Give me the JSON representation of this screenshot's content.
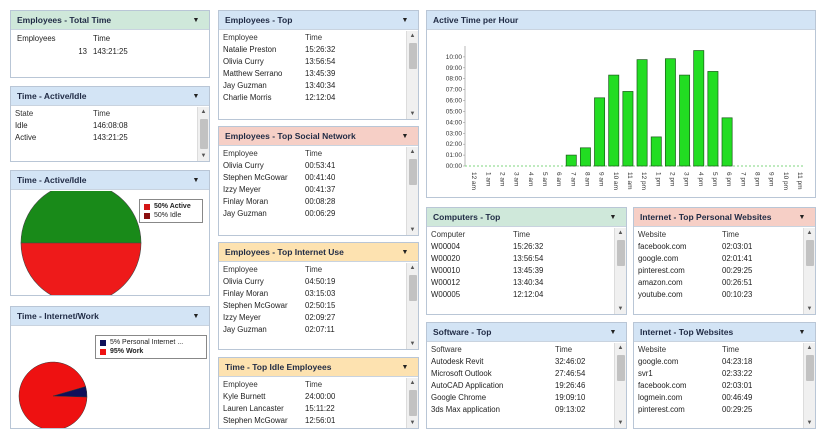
{
  "w1": {
    "title": "Employees - Total Time",
    "cols": [
      "Employees",
      "Time"
    ],
    "rows": [
      [
        "13",
        "143:21:25"
      ]
    ]
  },
  "w2": {
    "title": "Time - Active/Idle",
    "cols": [
      "State",
      "Time"
    ],
    "rows": [
      [
        "Idle",
        "146:08:08"
      ],
      [
        "Active",
        "143:21:25"
      ]
    ]
  },
  "w3": {
    "title": "Time - Active/Idle",
    "legend": [
      {
        "label": "50% Active",
        "color": "#1b8a1b"
      },
      {
        "label": "50% Idle",
        "color": "#e02020"
      }
    ],
    "slices": [
      50,
      50
    ]
  },
  "w4": {
    "title": "Time - Internet/Work",
    "legend": [
      {
        "label": "5% Personal Internet ...",
        "color": "#10105a"
      },
      {
        "label": "95% Work",
        "color": "#ee1111"
      }
    ],
    "slices": [
      5,
      95
    ]
  },
  "w5": {
    "title": "Employees - Top",
    "cols": [
      "Employee",
      "Time"
    ],
    "rows": [
      [
        "Natalie Preston",
        "15:26:32"
      ],
      [
        "Olivia Curry",
        "13:56:54"
      ],
      [
        "Matthew Serrano",
        "13:45:39"
      ],
      [
        "Jay Guzman",
        "13:40:34"
      ],
      [
        "Charlie Morris",
        "12:12:04"
      ]
    ]
  },
  "w6": {
    "title": "Employees - Top Social Network",
    "cols": [
      "Employee",
      "Time"
    ],
    "rows": [
      [
        "Olivia Curry",
        "00:53:41"
      ],
      [
        "Stephen McGowar",
        "00:41:40"
      ],
      [
        "Izzy Meyer",
        "00:41:37"
      ],
      [
        "Finlay Moran",
        "00:08:28"
      ],
      [
        "Jay Guzman",
        "00:06:29"
      ]
    ]
  },
  "w7": {
    "title": "Employees - Top Internet Use",
    "cols": [
      "Employee",
      "Time"
    ],
    "rows": [
      [
        "Olivia Curry",
        "04:50:19"
      ],
      [
        "Finlay Moran",
        "03:15:03"
      ],
      [
        "Stephen McGowar",
        "02:50:15"
      ],
      [
        "Izzy Meyer",
        "02:09:27"
      ],
      [
        "Jay Guzman",
        "02:07:11"
      ]
    ]
  },
  "w8": {
    "title": "Time - Top Idle Employees",
    "cols": [
      "Employee",
      "Time"
    ],
    "rows": [
      [
        "Kyle Burnett",
        "24:00:00"
      ],
      [
        "Lauren Lancaster",
        "15:11:22"
      ],
      [
        "Stephen McGowar",
        "12:56:01"
      ]
    ]
  },
  "w9": {
    "title": "Computers - Top",
    "cols": [
      "Computer",
      "Time"
    ],
    "rows": [
      [
        "W00004",
        "15:26:32"
      ],
      [
        "W00020",
        "13:56:54"
      ],
      [
        "W00010",
        "13:45:39"
      ],
      [
        "W00012",
        "13:40:34"
      ],
      [
        "W00005",
        "12:12:04"
      ]
    ]
  },
  "w10": {
    "title": "Software - Top",
    "cols": [
      "Software",
      "Time"
    ],
    "rows": [
      [
        "Autodesk Revit",
        "32:46:02"
      ],
      [
        "Microsoft Outlook",
        "27:46:54"
      ],
      [
        "AutoCAD Application",
        "19:26:46"
      ],
      [
        "Google Chrome",
        "19:09:10"
      ],
      [
        "3ds Max application",
        "09:13:02"
      ]
    ]
  },
  "w11": {
    "title": "Internet - Top Personal Websites",
    "cols": [
      "Website",
      "Time"
    ],
    "rows": [
      [
        "facebook.com",
        "02:03:01"
      ],
      [
        "google.com",
        "02:01:41"
      ],
      [
        "pinterest.com",
        "00:29:25"
      ],
      [
        "amazon.com",
        "00:26:51"
      ],
      [
        "youtube.com",
        "00:10:23"
      ]
    ]
  },
  "w12": {
    "title": "Internet - Top Websites",
    "cols": [
      "Website",
      "Time"
    ],
    "rows": [
      [
        "google.com",
        "04:23:18"
      ],
      [
        "svr1",
        "02:33:22"
      ],
      [
        "facebook.com",
        "02:03:01"
      ],
      [
        "logmein.com",
        "00:46:49"
      ],
      [
        "pinterest.com",
        "00:29:25"
      ]
    ]
  },
  "chart": {
    "title": "Active Time per Hour"
  },
  "chart_data": {
    "type": "bar",
    "categories": [
      "12 am",
      "1 am",
      "2 am",
      "3 am",
      "4 am",
      "5 am",
      "6 am",
      "7 am",
      "8 am",
      "9 am",
      "10 am",
      "11 am",
      "12 pm",
      "1 pm",
      "2 pm",
      "3 pm",
      "4 pm",
      "5 pm",
      "6 pm",
      "7 pm",
      "8 pm",
      "9 pm",
      "10 pm",
      "11 pm"
    ],
    "values_minutes": [
      0,
      0,
      0,
      0,
      0,
      0,
      0,
      60,
      100,
      375,
      500,
      410,
      585,
      160,
      590,
      500,
      635,
      520,
      265,
      0,
      0,
      0,
      0,
      0
    ],
    "ylim_minutes": [
      0,
      660
    ],
    "yticks": [
      "00:00",
      "01:00",
      "02:00",
      "03:00",
      "04:00",
      "05:00",
      "06:00",
      "07:00",
      "08:00",
      "09:00",
      "10:00"
    ],
    "bar_color": "#22dd22"
  },
  "icons": {
    "dropdown": "chevron-down-icon",
    "scroll_up": "scroll-up-icon",
    "scroll_down": "scroll-down-icon"
  }
}
